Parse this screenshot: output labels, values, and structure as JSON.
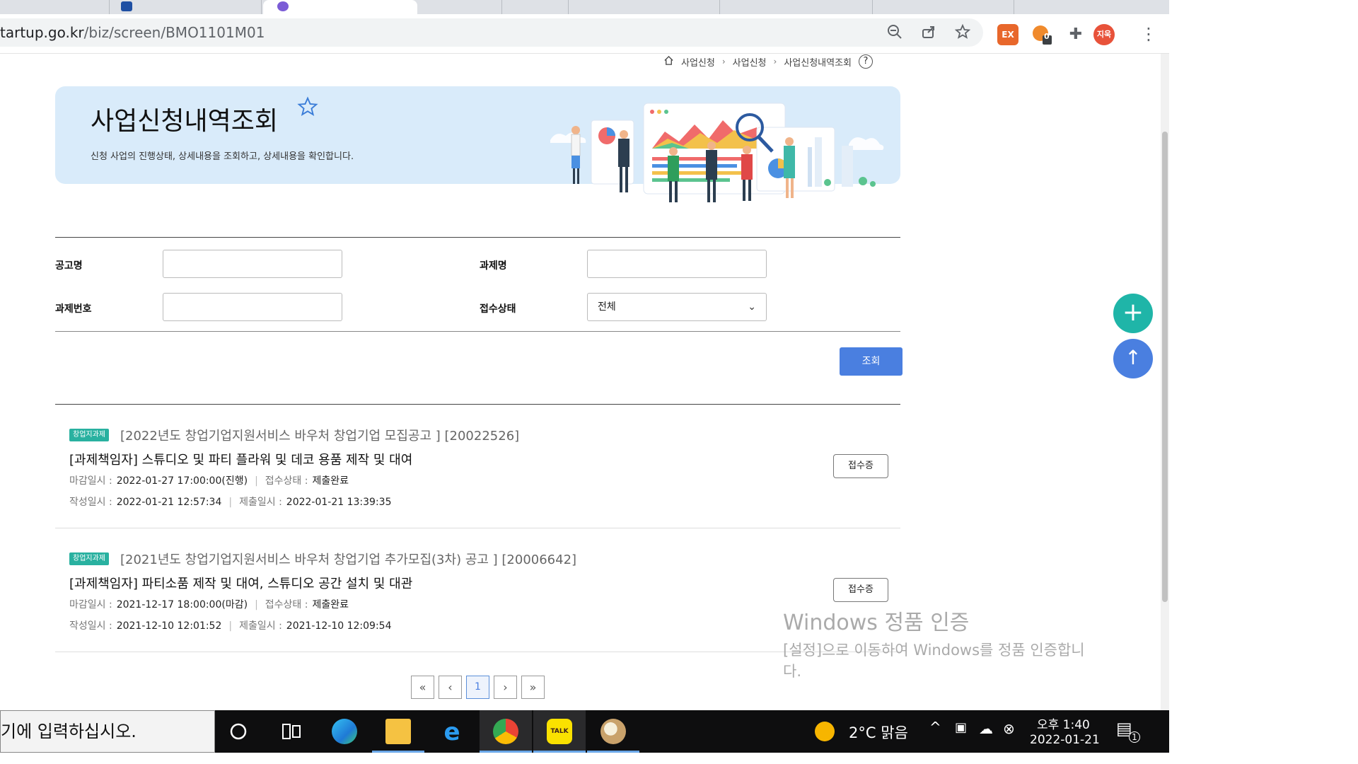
{
  "browser": {
    "url_prefix": "tartup.go.kr",
    "url_path": "/biz/screen/BMO1101M01",
    "ext_badge_count": "0",
    "profile_label": "지욱",
    "ex_label": "EX"
  },
  "breadcrumb": {
    "items": [
      "사업신청",
      "사업신청",
      "사업신청내역조회"
    ],
    "help": "?"
  },
  "hero": {
    "title": "사업신청내역조회",
    "description": "신청 사업의 진행상태, 상세내용을 조회하고, 상세내용을 확인합니다."
  },
  "filter": {
    "notice_label": "공고명",
    "task_label": "과제명",
    "task_no_label": "과제번호",
    "status_label": "접수상태",
    "status_value": "전체",
    "search_button": "조회"
  },
  "list": {
    "items": [
      {
        "badge": "창업지과제",
        "notice": "[2022년도 창업기업지원서비스 바우처 창업기업 모집공고 ] [20022526]",
        "task": "[과제책임자] 스튜디오 및 파티 플라워 및 데코 용품 제작 및 대여",
        "deadline_label": "마감일시 :",
        "deadline_value": "2022-01-27 17:00:00(진행)",
        "status_label": "접수상태 :",
        "status_value": "제출완료",
        "created_label": "작성일시 :",
        "created_value": "2022-01-21 12:57:34",
        "submitted_label": "제출일시 :",
        "submitted_value": "2022-01-21 13:39:35",
        "button": "접수증"
      },
      {
        "badge": "창업지과제",
        "notice": "[2021년도 창업기업지원서비스 바우처 창업기업 추가모집(3차) 공고 ] [20006642]",
        "task": "[과제책임자] 파티소품 제작 및 대여, 스튜디오 공간 설치 및 대관",
        "deadline_label": "마감일시 :",
        "deadline_value": "2021-12-17 18:00:00(마감)",
        "status_label": "접수상태 :",
        "status_value": "제출완료",
        "created_label": "작성일시 :",
        "created_value": "2021-12-10 12:01:52",
        "submitted_label": "제출일시 :",
        "submitted_value": "2021-12-10 12:09:54",
        "button": "접수증"
      }
    ]
  },
  "pager": {
    "first": "«",
    "prev": "‹",
    "current": "1",
    "next": "›",
    "last": "»"
  },
  "float": {
    "plus": "+",
    "up": "↑"
  },
  "watermark": {
    "line1": "Windows 정품 인증",
    "line2": "[설정]으로 이동하여 Windows를 정품 인증합니",
    "line3": "다."
  },
  "taskbar": {
    "search_text": "기에 입력하십시오.",
    "kakao_label": "TALK",
    "weather": "2°C  맑음",
    "time": "오후 1:40",
    "date": "2022-01-21",
    "notif_count": "1"
  },
  "colors": {
    "accent": "#4a7fe0",
    "badge": "#29b1a0",
    "hero_bg": "#d9ebfa",
    "plus_button": "#1fb5a8",
    "up_button": "#4a7fe0"
  }
}
